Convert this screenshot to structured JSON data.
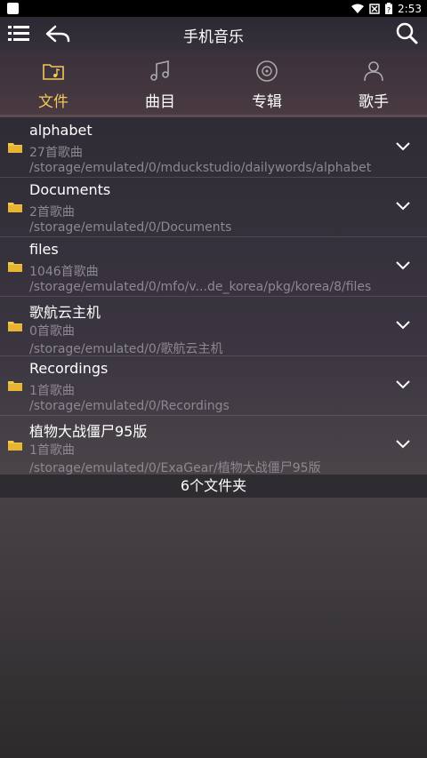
{
  "status": {
    "time": "2:53"
  },
  "appbar": {
    "title": "手机音乐"
  },
  "tabs": [
    {
      "label": "文件",
      "icon": "folder-music-icon",
      "active": true
    },
    {
      "label": "曲目",
      "icon": "music-note-icon",
      "active": false
    },
    {
      "label": "专辑",
      "icon": "disc-icon",
      "active": false
    },
    {
      "label": "歌手",
      "icon": "person-icon",
      "active": false
    }
  ],
  "folders": [
    {
      "name": "alphabet",
      "count": "27首歌曲",
      "path": "/storage/emulated/0/mduckstudio/dailywords/alphabet"
    },
    {
      "name": "Documents",
      "count": "2首歌曲",
      "path": "/storage/emulated/0/Documents"
    },
    {
      "name": "files",
      "count": "1046首歌曲",
      "path": "/storage/emulated/0/mfo/v...de_korea/pkg/korea/8/files"
    },
    {
      "name": "歌航云主机",
      "count": "0首歌曲",
      "path": "/storage/emulated/0/歌航云主机"
    },
    {
      "name": "Recordings",
      "count": "1首歌曲",
      "path": "/storage/emulated/0/Recordings"
    },
    {
      "name": "植物大战僵尸95版",
      "count": "1首歌曲",
      "path": "/storage/emulated/0/ExaGear/植物大战僵尸95版"
    }
  ],
  "footer": {
    "text": "6个文件夹"
  },
  "colors": {
    "accent": "#f3c85a",
    "folder": "#f2c84b"
  }
}
